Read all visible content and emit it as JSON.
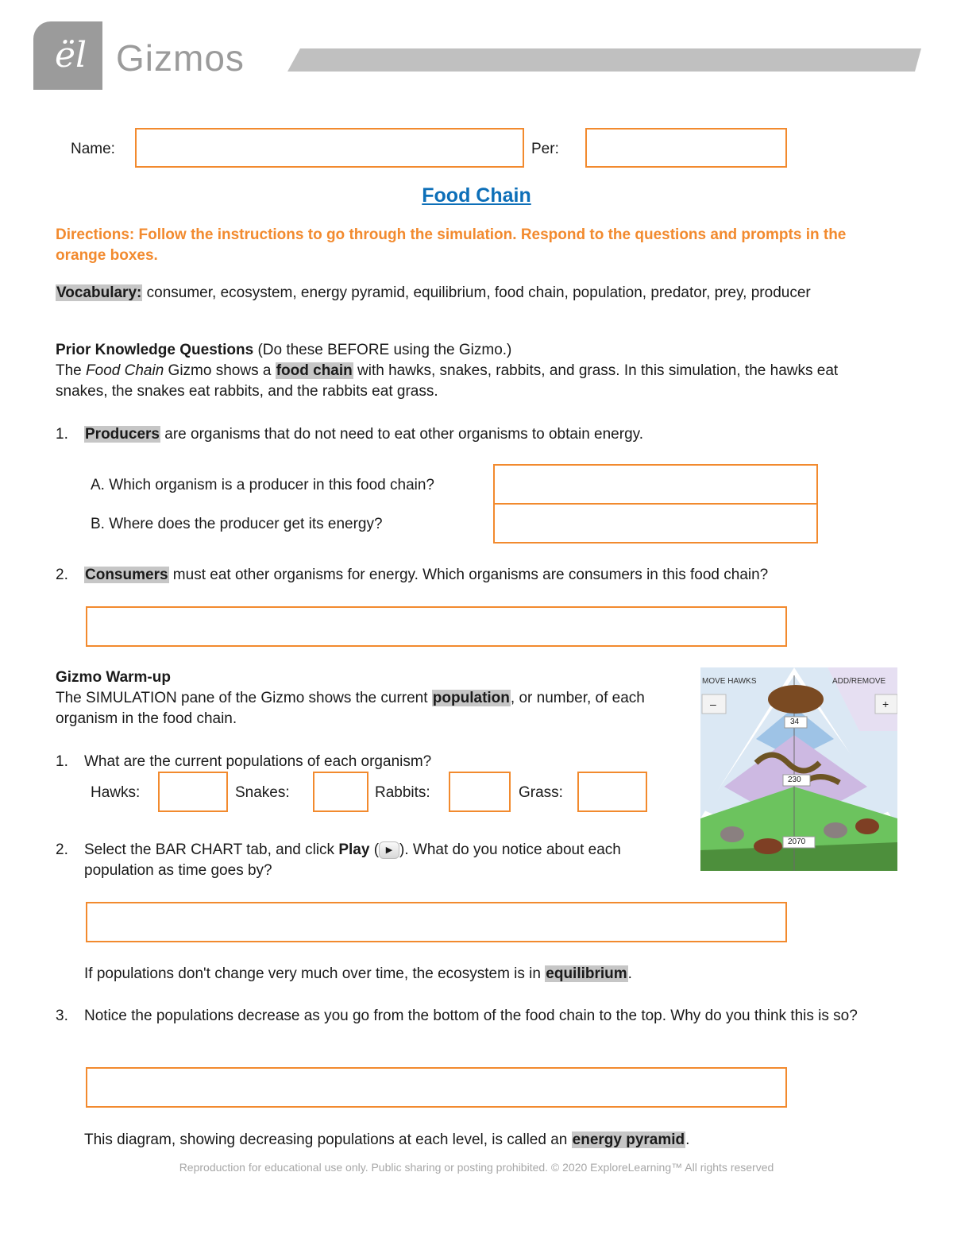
{
  "header": {
    "logo_glyph": "ël",
    "brand": "Gizmos"
  },
  "form": {
    "name_label": "Name:",
    "name_value": "",
    "period_label": "Per:",
    "period_value": ""
  },
  "title": "Food Chain",
  "directions": "Directions: Follow the instructions to go through the simulation. Respond to the questions and prompts in the orange boxes.",
  "vocabulary": {
    "label": "Vocabulary:",
    "terms": "consumer, ecosystem, energy pyramid, equilibrium, food chain, population, predator, prey, producer"
  },
  "prior_knowledge": {
    "heading": "Prior Knowledge Questions",
    "heading_note": "(Do these BEFORE using the Gizmo.)",
    "intro_pre": "The ",
    "intro_italic": "Food Chain",
    "intro_mid": " Gizmo shows a ",
    "intro_term": "food chain",
    "intro_post": " with hawks, snakes, rabbits, and grass. In this simulation, the hawks eat snakes, the snakes eat rabbits, and the rabbits eat grass.",
    "q1": {
      "number": "1.",
      "term": "Producers",
      "text": " are organisms that do not need to eat other organisms to obtain energy.",
      "a_label": "A. Which organism is a producer in this food chain?",
      "a_value": "",
      "b_label": "B. Where does the producer get its energy?",
      "b_value": ""
    },
    "q2": {
      "number": "2.",
      "term": "Consumers",
      "text": " must eat other organisms for energy. Which organisms are consumers in this food chain?",
      "answer": ""
    }
  },
  "warmup": {
    "heading": "Gizmo Warm-up",
    "intro_pre": "The SIMULATION pane of the Gizmo shows the current ",
    "intro_term": "population",
    "intro_post": ", or number, of each organism in the food chain.",
    "q1": {
      "number": "1.",
      "text": "What are the current populations of each organism?",
      "fields": [
        {
          "label": "Hawks:",
          "value": ""
        },
        {
          "label": "Snakes:",
          "value": ""
        },
        {
          "label": "Rabbits:",
          "value": ""
        },
        {
          "label": "Grass:",
          "value": ""
        }
      ]
    },
    "q2": {
      "number": "2.",
      "text_pre": "Select the BAR CHART tab, and click ",
      "play_label": "Play",
      "text_paren_open": " (",
      "text_post": "). What do you notice about each population as time goes by?",
      "answer": "",
      "note_pre": "If populations don't change very much over time, the ecosystem is in ",
      "note_term": "equilibrium",
      "note_post": "."
    },
    "q3": {
      "number": "3.",
      "text": "Notice the populations decrease as you go from the bottom of the food chain to the top. Why do you think this is so?",
      "answer": "",
      "note_pre": "This diagram, showing decreasing populations at each level, is called an ",
      "note_term": "energy pyramid",
      "note_post": "."
    },
    "simulation": {
      "move_label": "MOVE HAWKS",
      "add_label": "ADD/REMOVE",
      "minus": "–",
      "plus": "+",
      "hawks": "34",
      "snakes": "230",
      "rabbits": "2070"
    }
  },
  "footer": "Reproduction for educational use only. Public sharing or posting prohibited. © 2020 ExploreLearning™ All rights reserved",
  "colors": {
    "orange": "#f28a2e",
    "title_blue": "#0d6fb8",
    "highlight": "#c6c6c6"
  }
}
